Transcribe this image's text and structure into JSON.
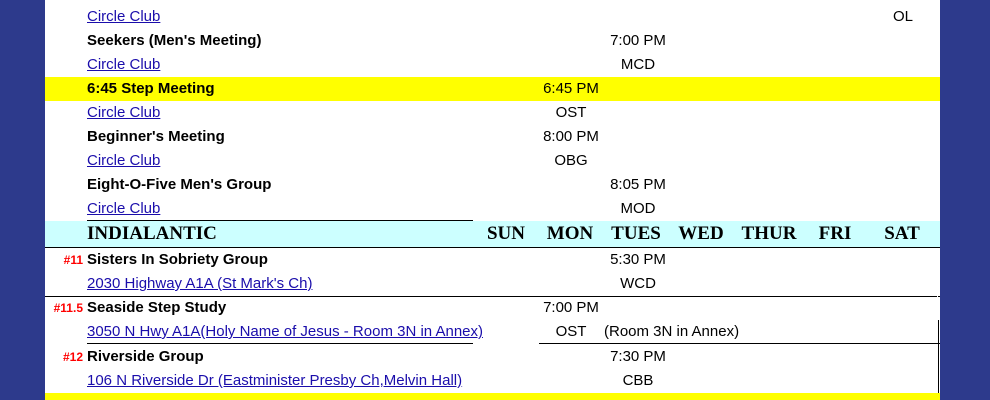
{
  "partial_top": {
    "link": "Circle Club",
    "sat": "OL"
  },
  "meetings_top": [
    {
      "name": "Seekers (Men's Meeting)",
      "time": "7:00 PM",
      "time_day": "tue",
      "link": "Circle Club",
      "code": "MCD",
      "code_day": "tue",
      "highlight": false
    },
    {
      "name": "6:45 Step Meeting",
      "time": "6:45 PM",
      "time_day": "mon",
      "link": "Circle Club",
      "code": "OST",
      "code_day": "mon",
      "highlight": true
    },
    {
      "name": "Beginner's Meeting",
      "time": "8:00 PM",
      "time_day": "mon",
      "link": "Circle Club",
      "code": "OBG",
      "code_day": "mon",
      "highlight": false
    },
    {
      "name": "Eight-O-Five Men's Group",
      "time": "8:05 PM",
      "time_day": "tue",
      "link": "Circle Club",
      "code": "MOD",
      "code_day": "tue",
      "highlight": false
    }
  ],
  "section": {
    "region": "INDIALANTIC",
    "days": [
      "SUN",
      "MON",
      "TUES",
      "WED",
      "THUR",
      "FRI",
      "SAT"
    ]
  },
  "meetings_bottom": [
    {
      "num": "#11",
      "name": "Sisters In Sobriety Group",
      "time": "5:30 PM",
      "time_day": "tue",
      "link": "2030 Highway A1A (St Mark's Ch)",
      "code": "WCD",
      "code_day": "tue",
      "note": ""
    },
    {
      "num": "#11.5",
      "name": "Seaside Step Study",
      "time": "7:00 PM",
      "time_day": "mon",
      "link": "3050 N Hwy A1A(Holy Name of Jesus - Room 3N in Annex)",
      "code": "OST",
      "code_day": "mon",
      "note": "(Room 3N in Annex)"
    },
    {
      "num": "#12",
      "name": "Riverside Group",
      "time": "7:30 PM",
      "time_day": "tue",
      "link": "106 N Riverside Dr (Eastminister Presby Ch,Melvin Hall)",
      "code": "CBB",
      "code_day": "tue",
      "note": ""
    }
  ]
}
